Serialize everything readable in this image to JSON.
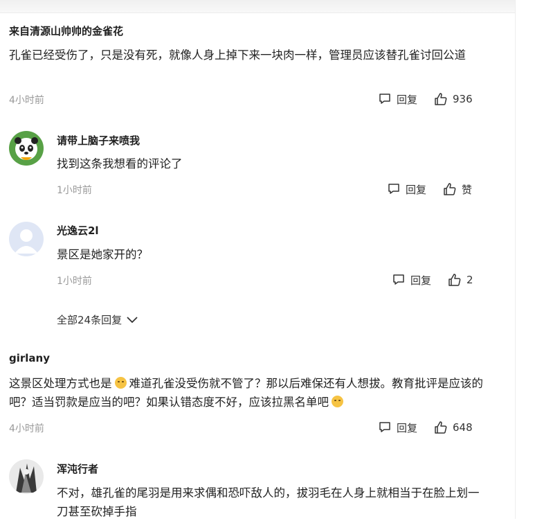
{
  "comments": [
    {
      "username": "来自清源山帅帅的金雀花",
      "text": "孔雀已经受伤了，只是没有死，就像人身上掉下来一块肉一样，管理员应该替孔雀讨回公道",
      "time": "4小时前",
      "reply_label": "回复",
      "likes": "936"
    },
    {
      "username": "girlany",
      "text_part1": "这景区处理方式也是",
      "text_part2": "难道孔雀没受伤就不管了？那以后难保还有人想拔。教育批评是应该的吧？适当罚款是应当的吧？如果认错态度不好，应该拉黑名单吧",
      "time": "4小时前",
      "reply_label": "回复",
      "likes": "648"
    },
    {
      "username": "浑沌行者",
      "text": "不对，雄孔雀的尾羽是用来求偶和恐吓敌人的，拔羽毛在人身上就相当于在脸上划一刀甚至砍掉手指"
    }
  ],
  "replies": [
    {
      "username": "请带上脑子来喷我",
      "text": "找到这条我想看的评论了",
      "time": "1小时前",
      "reply_label": "回复",
      "likes": "赞"
    },
    {
      "username": "光逸云2l",
      "text": "景区是她家开的？",
      "time": "1小时前",
      "reply_label": "回复",
      "likes": "2"
    }
  ],
  "view_all_replies": "全部24条回复",
  "icons": {
    "reply": "comment-bubble-icon",
    "like": "thumbs-up-icon",
    "expand": "chevron-down-icon",
    "emoji": "emoji-icon"
  },
  "colors": {
    "text": "#222222",
    "meta": "#999999",
    "accent": "#333333"
  }
}
